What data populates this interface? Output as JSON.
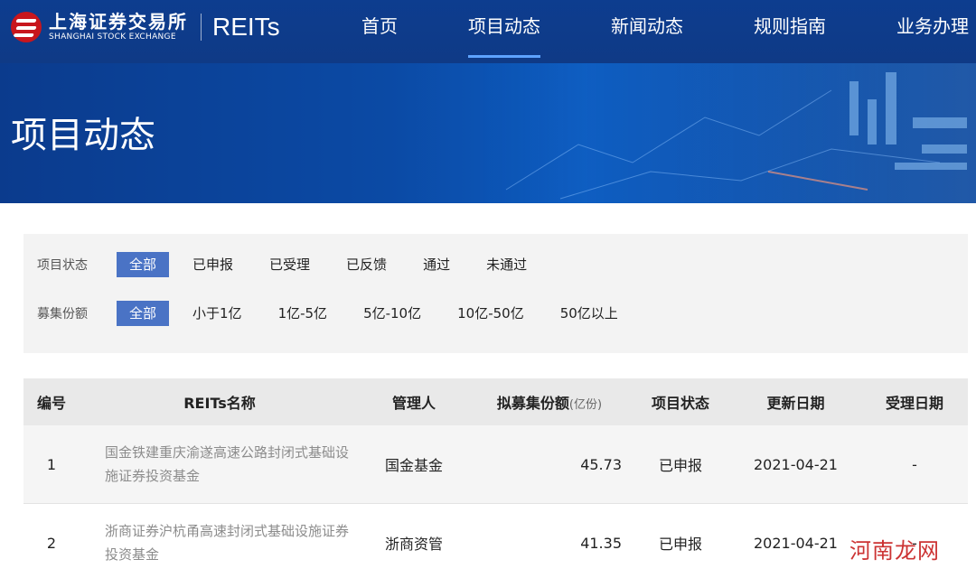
{
  "header": {
    "logo_cn": "上海证券交易所",
    "logo_en": "SHANGHAI STOCK EXCHANGE",
    "product": "REITs",
    "nav": [
      {
        "label": "首页"
      },
      {
        "label": "项目动态"
      },
      {
        "label": "新闻动态"
      },
      {
        "label": "规则指南"
      },
      {
        "label": "业务办理"
      }
    ],
    "active_nav": "项目动态"
  },
  "banner": {
    "title": "项目动态"
  },
  "filters": {
    "status": {
      "label": "项目状态",
      "options": [
        "全部",
        "已申报",
        "已受理",
        "已反馈",
        "通过",
        "未通过"
      ],
      "selected": "全部"
    },
    "amount": {
      "label": "募集份额",
      "options": [
        "全部",
        "小于1亿",
        "1亿-5亿",
        "5亿-10亿",
        "10亿-50亿",
        "50亿以上"
      ],
      "selected": "全部"
    }
  },
  "table": {
    "headers": {
      "no": "编号",
      "name": "REITs名称",
      "manager": "管理人",
      "amount": "拟募集份额",
      "amount_unit": "(亿份)",
      "status": "项目状态",
      "updated": "更新日期",
      "accepted": "受理日期"
    },
    "rows": [
      {
        "no": "1",
        "name": "国金铁建重庆渝遂高速公路封闭式基础设施证券投资基金",
        "manager": "国金基金",
        "amount": "45.73",
        "status": "已申报",
        "updated": "2021-04-21",
        "accepted": "-"
      },
      {
        "no": "2",
        "name": "浙商证券沪杭甬高速封闭式基础设施证券投资基金",
        "manager": "浙商资管",
        "amount": "41.35",
        "status": "已申报",
        "updated": "2021-04-21",
        "accepted": "-"
      }
    ]
  },
  "watermark": "河南龙网",
  "colors": {
    "header_bg": "#0f3a86",
    "selected_filter": "#4a73c5",
    "brand_red": "#c8161d"
  }
}
